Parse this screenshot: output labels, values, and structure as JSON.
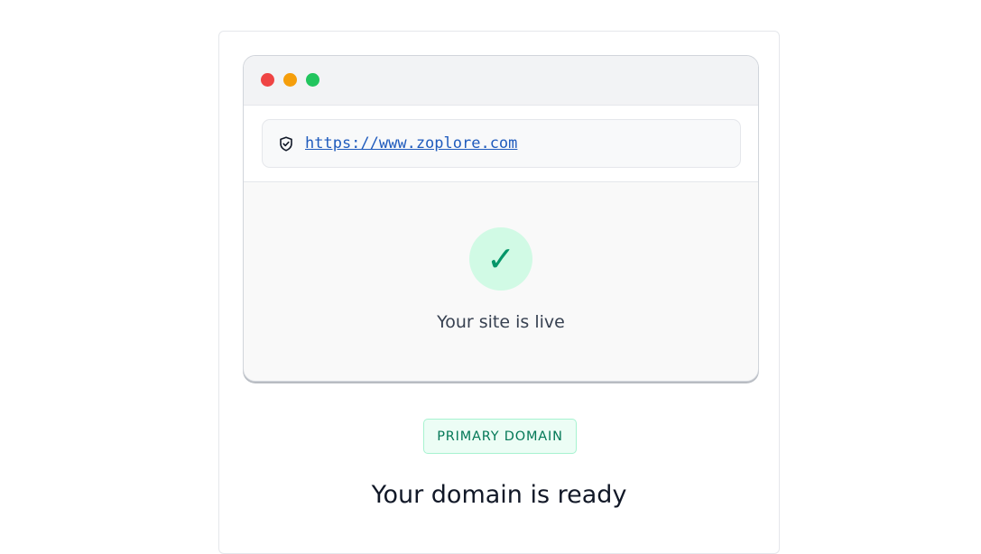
{
  "browser": {
    "traffic_lights": {
      "close_color": "#ef4444",
      "minimize_color": "#f59e0b",
      "maximize_color": "#22c55e"
    },
    "address_bar": {
      "icon": "shield-check-icon",
      "url": "https://www.zoplore.com"
    },
    "status": {
      "icon": "checkmark-icon",
      "icon_glyph": "✓",
      "message": "Your site is live"
    }
  },
  "badge": {
    "label": "PRIMARY DOMAIN"
  },
  "headline": "Your domain is ready"
}
